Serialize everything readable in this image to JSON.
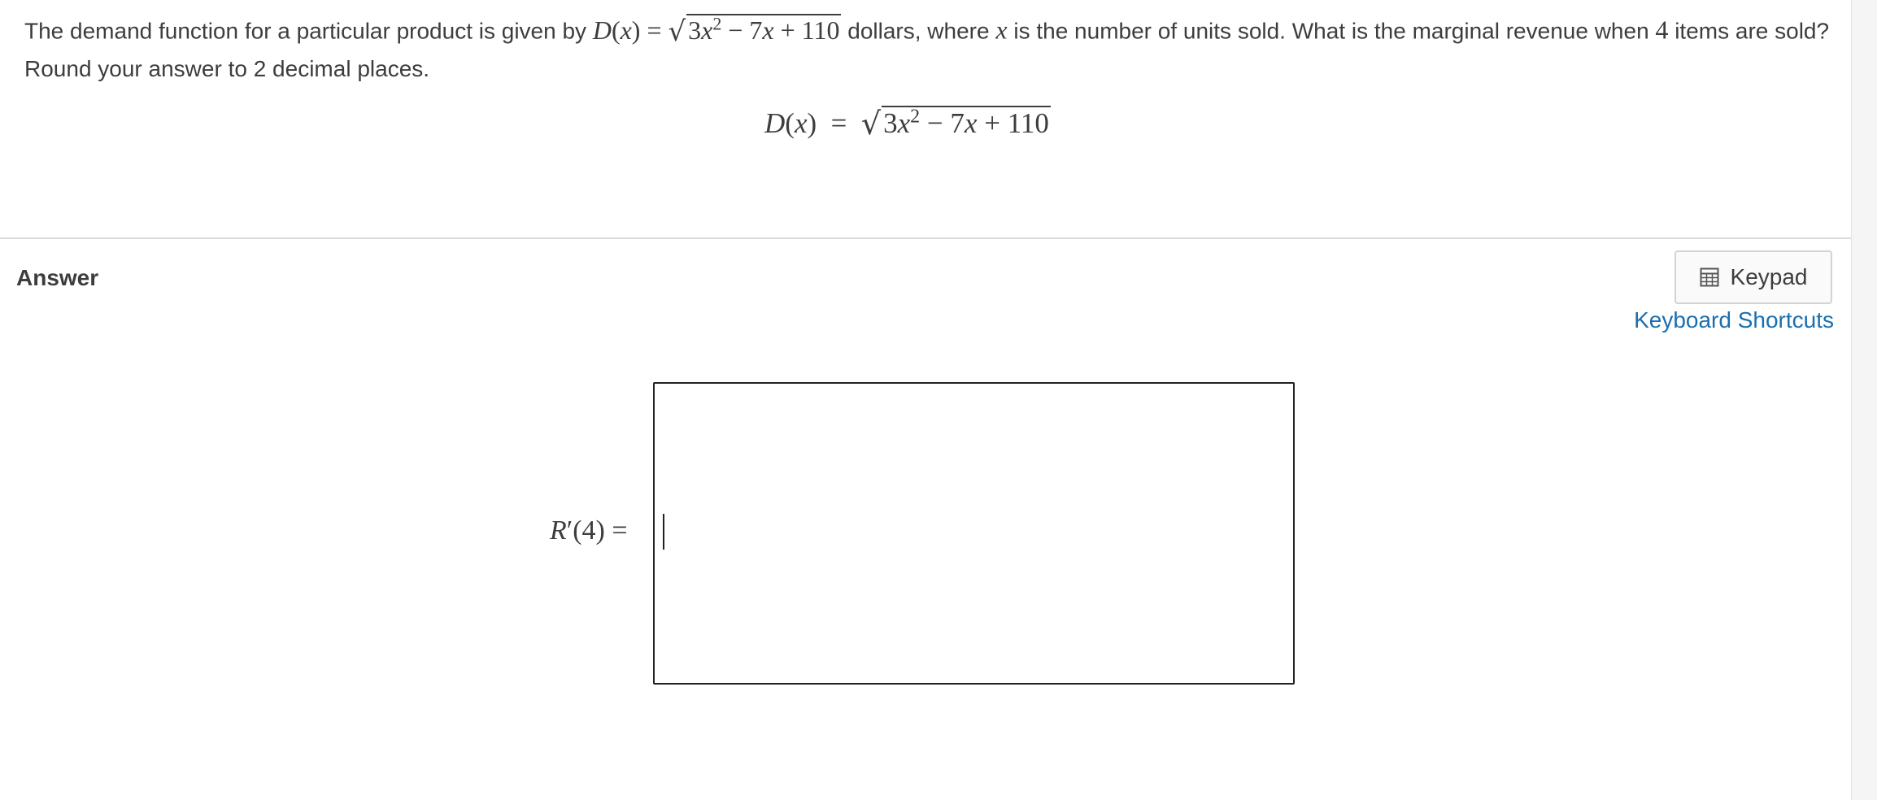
{
  "question": {
    "text_before": "The demand function for a particular product is given by",
    "func_name": "D",
    "func_var": "x",
    "equals": "=",
    "radicand_a": "3",
    "radicand_var1": "x",
    "radicand_exp": "2",
    "radicand_b": "− 7",
    "radicand_var2": "x",
    "radicand_c": "+ 110",
    "text_after_1": "dollars, where",
    "var_x": "x",
    "text_after_2": "is the number of units sold. What is the marginal revenue when",
    "quantity": "4",
    "text_after_3": "items are sold? Round your answer to 2 decimal places."
  },
  "display_equation": {
    "func_name": "D",
    "func_var": "x",
    "equals": "=",
    "radicand_a": "3",
    "radicand_var1": "x",
    "radicand_exp": "2",
    "radicand_b": "− 7",
    "radicand_var2": "x",
    "radicand_c": "+ 110"
  },
  "answer": {
    "heading": "Answer",
    "keypad_label": "Keypad",
    "shortcuts_label": "Keyboard Shortcuts",
    "prompt_func": "R",
    "prompt_prime": "′",
    "prompt_arg": "(4)",
    "prompt_equals": "=",
    "input_value": ""
  },
  "icons": {
    "keypad": "calculator-icon"
  }
}
